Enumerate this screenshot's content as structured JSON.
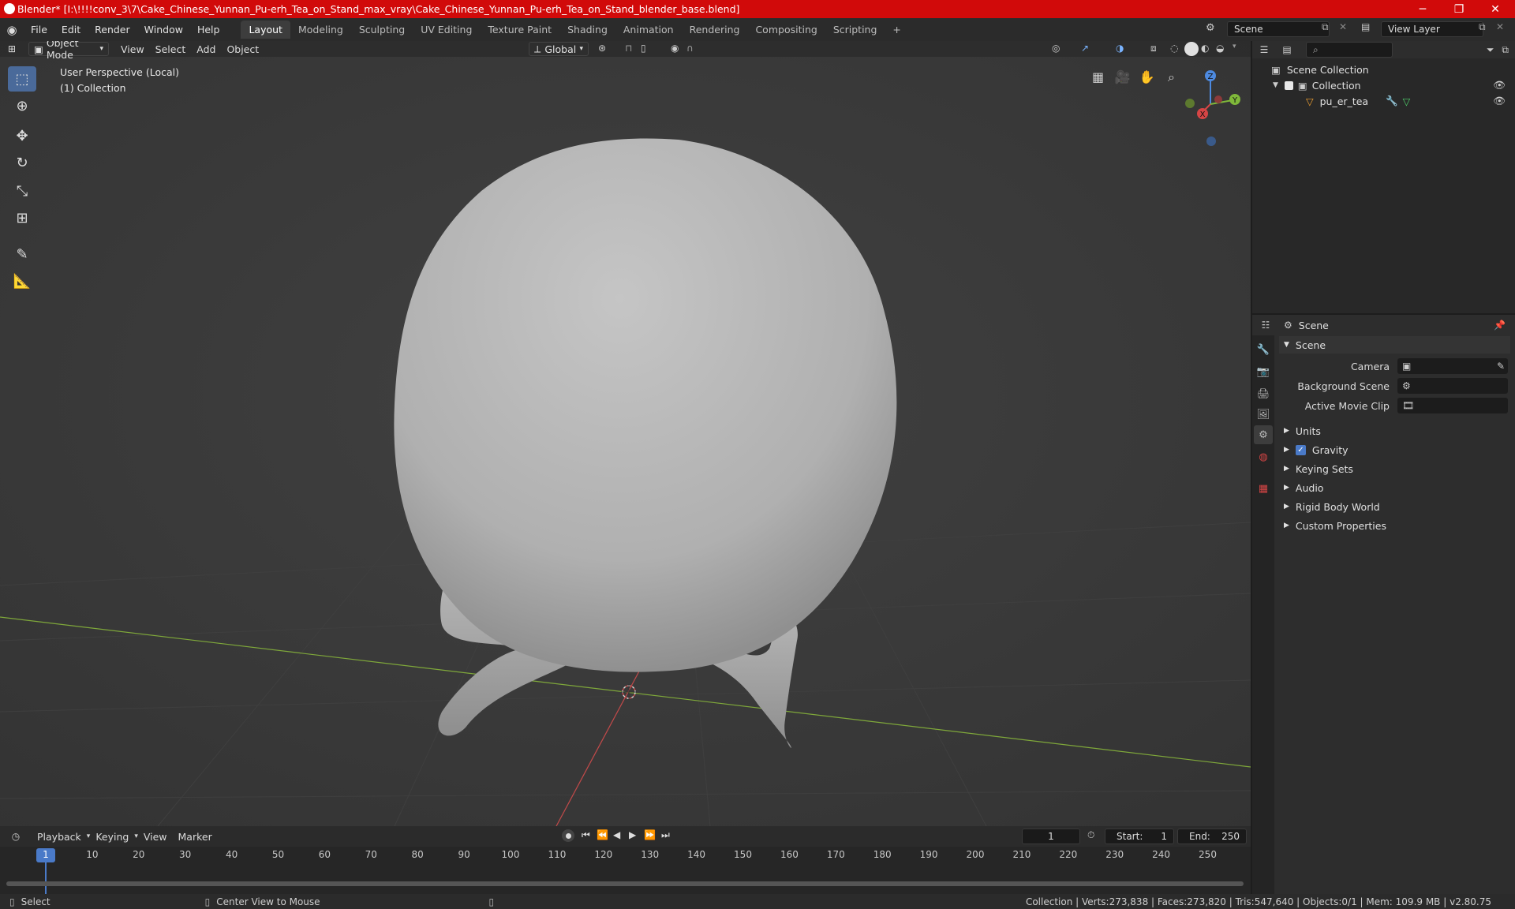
{
  "titlebar": {
    "title": "Blender* [I:\\!!!!conv_3\\7\\Cake_Chinese_Yunnan_Pu-erh_Tea_on_Stand_max_vray\\Cake_Chinese_Yunnan_Pu-erh_Tea_on_Stand_blender_base.blend]",
    "minimize": "─",
    "maximize": "❐",
    "close": "✕"
  },
  "menu": [
    "File",
    "Edit",
    "Render",
    "Window",
    "Help"
  ],
  "workspaces": [
    "Layout",
    "Modeling",
    "Sculpting",
    "UV Editing",
    "Texture Paint",
    "Shading",
    "Animation",
    "Rendering",
    "Compositing",
    "Scripting"
  ],
  "workspace_add": "+",
  "scene_field": "Scene",
  "view_layer_field": "View Layer",
  "viewport": {
    "mode": "Object Mode",
    "menus": [
      "View",
      "Select",
      "Add",
      "Object"
    ],
    "transform_orientation": "Global",
    "overlay_title": "User Perspective (Local)",
    "overlay_collection": "(1) Collection",
    "gizmo": {
      "x": "X",
      "y": "Y",
      "z": "Z"
    },
    "background": "#393939",
    "x_axis_color": "#c24a4a",
    "y_axis_color": "#7fa83a"
  },
  "outliner": {
    "search_placeholder": "",
    "scene_collection": "Scene Collection",
    "collection": "Collection",
    "object": "pu_er_tea"
  },
  "properties": {
    "header_title": "Scene",
    "panel_title": "Scene",
    "camera_label": "Camera",
    "background_scene_label": "Background Scene",
    "active_movie_clip_label": "Active Movie Clip",
    "subpanels": [
      "Units",
      "Gravity",
      "Keying Sets",
      "Audio",
      "Rigid Body World",
      "Custom Properties"
    ],
    "gravity_checked": true
  },
  "timeline": {
    "menus": [
      "Playback",
      "Keying",
      "View",
      "Marker"
    ],
    "current_frame": "1",
    "start_label": "Start:",
    "start_value": "1",
    "end_label": "End:",
    "end_value": "250",
    "ruler": [
      "1",
      "10",
      "20",
      "30",
      "40",
      "50",
      "60",
      "70",
      "80",
      "90",
      "100",
      "110",
      "120",
      "130",
      "140",
      "150",
      "160",
      "170",
      "180",
      "190",
      "200",
      "210",
      "220",
      "230",
      "240",
      "250"
    ]
  },
  "statusbar": {
    "select": "Select",
    "center": "Center View to Mouse",
    "stats": "Collection | Verts:273,838 | Faces:273,820 | Tris:547,640 | Objects:0/1 | Mem: 109.9 MB | v2.80.75"
  }
}
